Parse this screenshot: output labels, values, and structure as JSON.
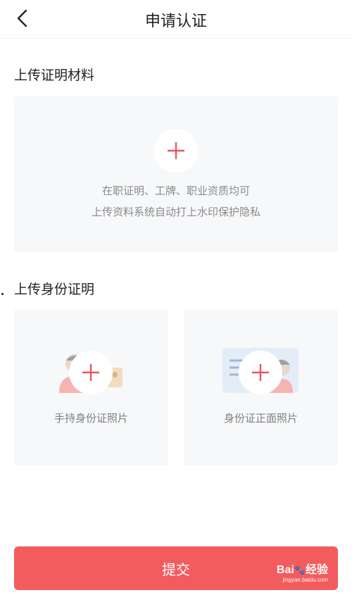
{
  "header": {
    "title": "申请认证",
    "back_icon": "chevron-left-icon"
  },
  "material_section": {
    "title": "上传证明材料",
    "hint_line1": "在职证明、工牌、职业资质均可",
    "hint_line2": "上传资料系统自动打上水印保护隐私"
  },
  "id_section": {
    "title": "上传身份证明",
    "cards": [
      {
        "label": "手持身份证照片"
      },
      {
        "label": "身份证正面照片"
      }
    ]
  },
  "submit": {
    "label": "提交"
  },
  "watermark": {
    "brand": "Bai",
    "brand_suffix": "经验",
    "url": "jingyan.baidu.com"
  },
  "colors": {
    "accent": "#f25c5e",
    "card_bg": "#f7f8fa",
    "plus": "#e8585a"
  }
}
